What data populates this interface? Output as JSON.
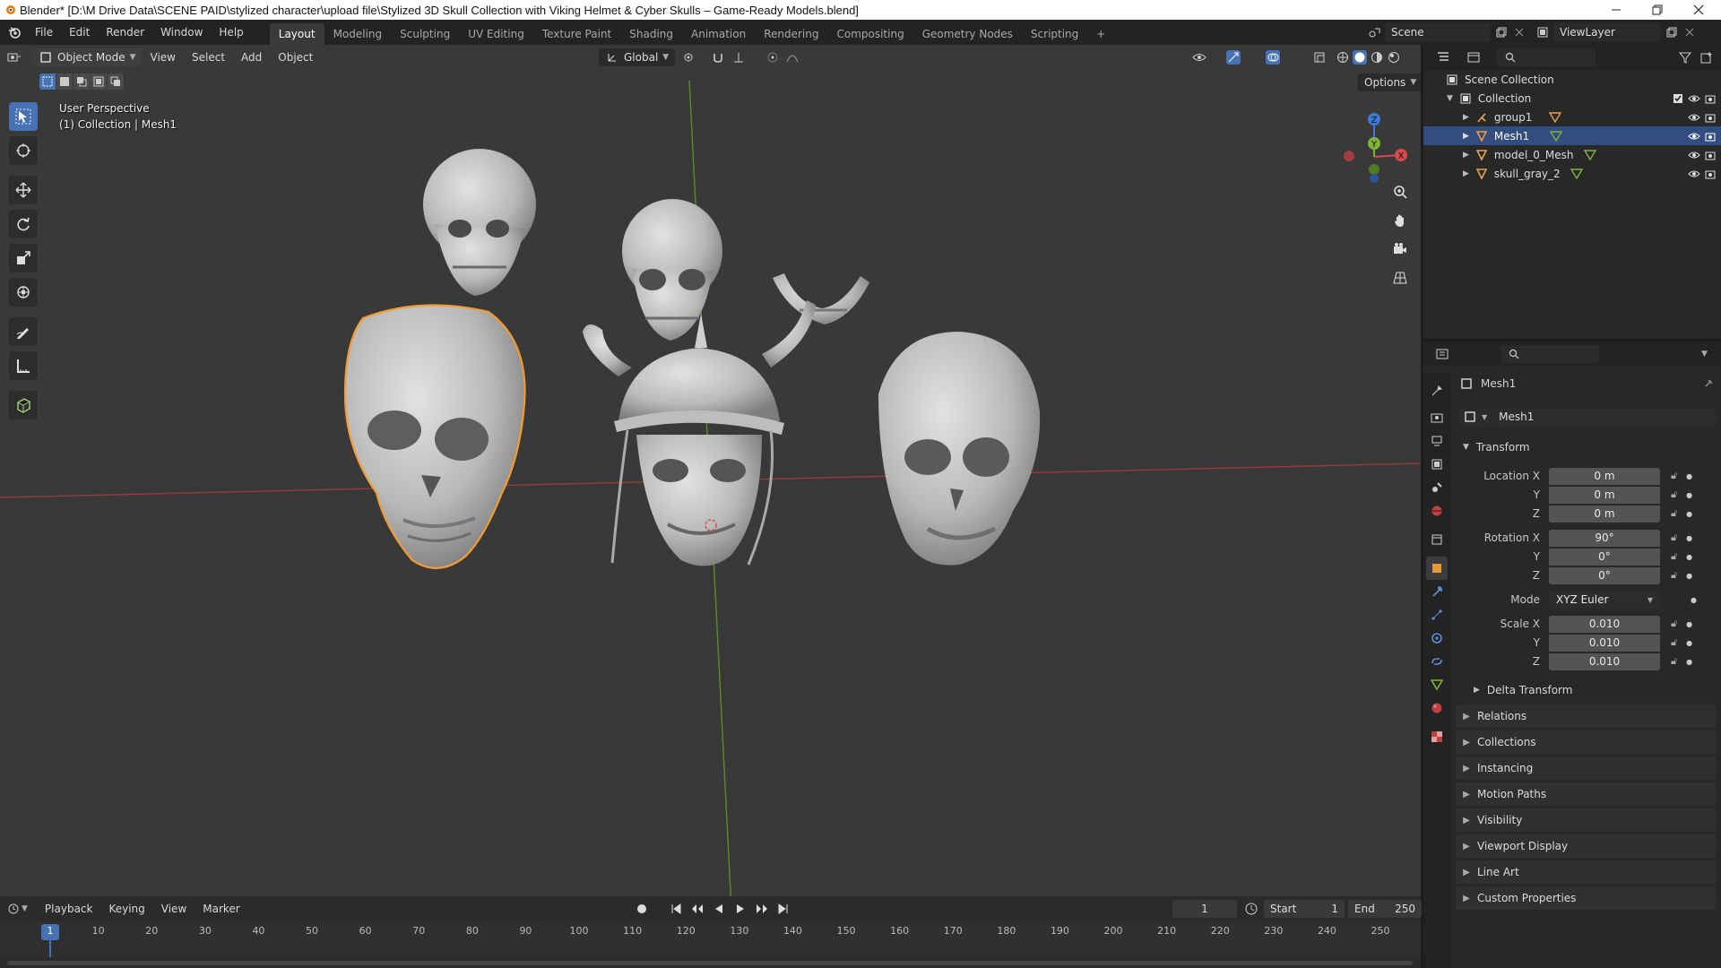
{
  "window": {
    "title": "Blender* [D:\\M Drive Data\\SCENE PAID\\stylized character\\upload file\\Stylized 3D Skull Collection with Viking Helmet & Cyber Skulls – Game-Ready Models.blend]"
  },
  "menus": [
    "File",
    "Edit",
    "Render",
    "Window",
    "Help"
  ],
  "workspaces": {
    "tabs": [
      "Layout",
      "Modeling",
      "Sculpting",
      "UV Editing",
      "Texture Paint",
      "Shading",
      "Animation",
      "Rendering",
      "Compositing",
      "Geometry Nodes",
      "Scripting"
    ],
    "active": "Layout",
    "add": "+"
  },
  "scene": {
    "name": "Scene",
    "view_layer": "ViewLayer"
  },
  "viewport": {
    "mode": "Object Mode",
    "menus": [
      "View",
      "Select",
      "Add",
      "Object"
    ],
    "orientation": "Global",
    "options_label": "Options",
    "overlay_line1": "User Perspective",
    "overlay_line2": "(1) Collection | Mesh1",
    "gizmo": {
      "x": "X",
      "y": "Y",
      "z": "Z"
    }
  },
  "tools": [
    "select-box",
    "cursor",
    "move",
    "rotate",
    "scale",
    "transform",
    "annotate",
    "measure",
    "add-cube"
  ],
  "outliner": {
    "root": "Scene Collection",
    "collection": "Collection",
    "items": [
      {
        "name": "group1",
        "selected": false
      },
      {
        "name": "Mesh1",
        "selected": true
      },
      {
        "name": "model_0_Mesh",
        "selected": false
      },
      {
        "name": "skull_gray_2",
        "selected": false
      }
    ]
  },
  "properties": {
    "object_name": "Mesh1",
    "datablock_name": "Mesh1",
    "transform_label": "Transform",
    "location": {
      "label": "Location X",
      "x": "0 m",
      "y": "0 m",
      "z": "0 m"
    },
    "rotation": {
      "label": "Rotation X",
      "x": "90°",
      "y": "0°",
      "z": "0°"
    },
    "mode": {
      "label": "Mode",
      "value": "XYZ Euler"
    },
    "scale": {
      "label": "Scale X",
      "x": "0.010",
      "y": "0.010",
      "z": "0.010"
    },
    "axis_labels": {
      "y": "Y",
      "z": "Z"
    },
    "delta": "Delta Transform",
    "sections": [
      "Relations",
      "Collections",
      "Instancing",
      "Motion Paths",
      "Visibility",
      "Viewport Display",
      "Line Art",
      "Custom Properties"
    ]
  },
  "timeline": {
    "menus": [
      "Playback",
      "Keying",
      "View",
      "Marker"
    ],
    "current_frame": "1",
    "start_label": "Start",
    "start": "1",
    "end_label": "End",
    "end": "250",
    "ticks": [
      "1",
      "10",
      "20",
      "30",
      "40",
      "50",
      "60",
      "70",
      "80",
      "90",
      "100",
      "110",
      "120",
      "130",
      "140",
      "150",
      "160",
      "170",
      "180",
      "190",
      "200",
      "210",
      "220",
      "230",
      "240",
      "250"
    ]
  },
  "colors": {
    "accent": "#4772b3",
    "selection_outline": "#f39c34",
    "axis_x": "#d94a4a",
    "axis_y": "#7db33a",
    "axis_z": "#3d7ad6",
    "panel_bg": "#282828",
    "viewport_bg": "#393939"
  }
}
